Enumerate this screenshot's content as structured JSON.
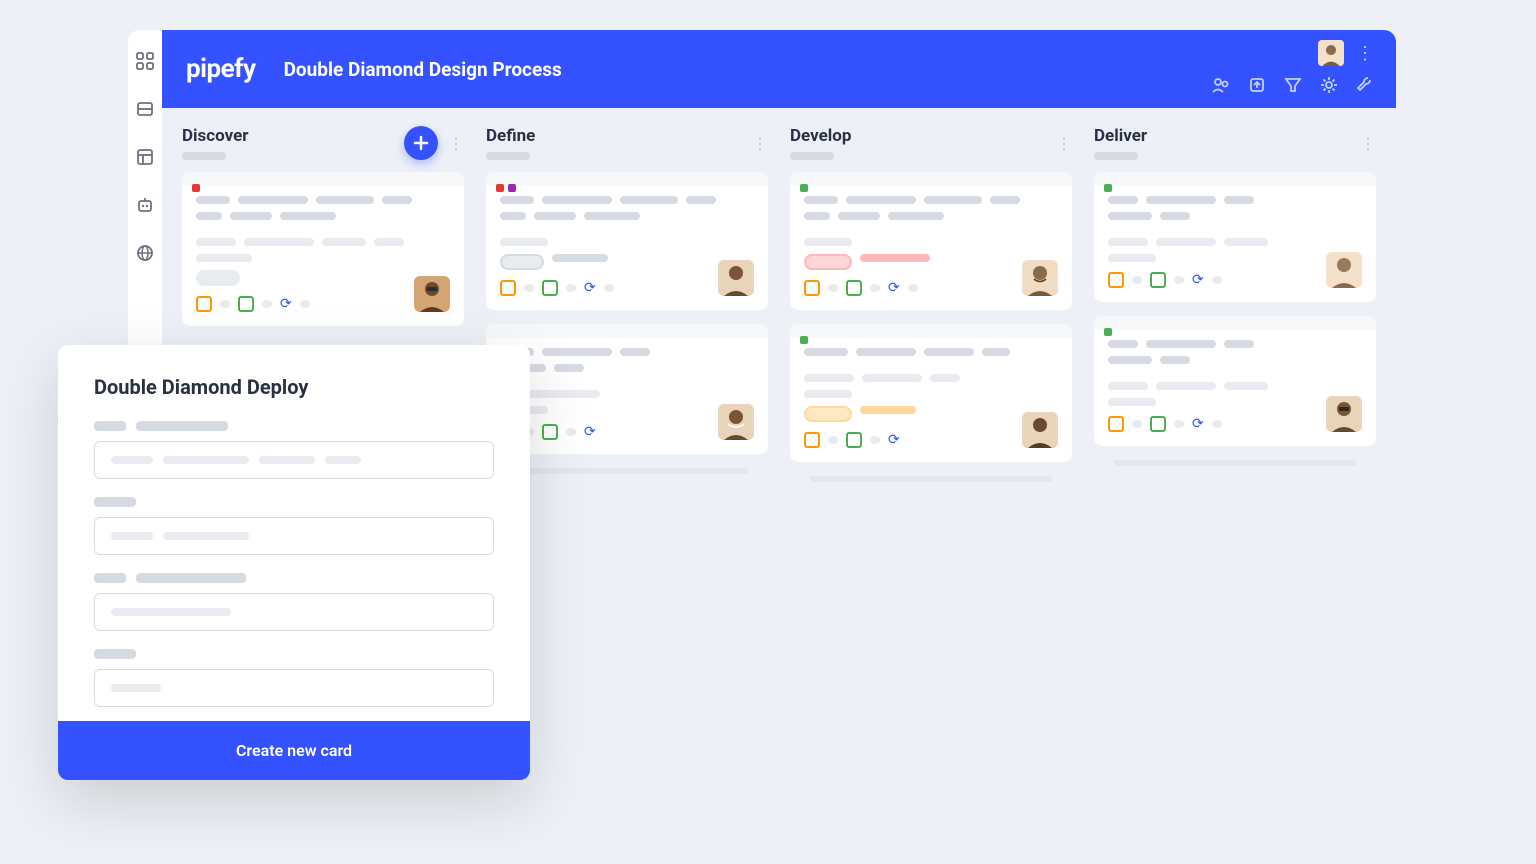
{
  "brand": "pipefy",
  "board_title": "Double Diamond Design Process",
  "columns": [
    {
      "name": "Discover",
      "add_button": true
    },
    {
      "name": "Define",
      "add_button": false
    },
    {
      "name": "Develop",
      "add_button": false
    },
    {
      "name": "Deliver",
      "add_button": false
    }
  ],
  "modal": {
    "title": "Double Diamond Deploy",
    "submit_label": "Create new card"
  }
}
